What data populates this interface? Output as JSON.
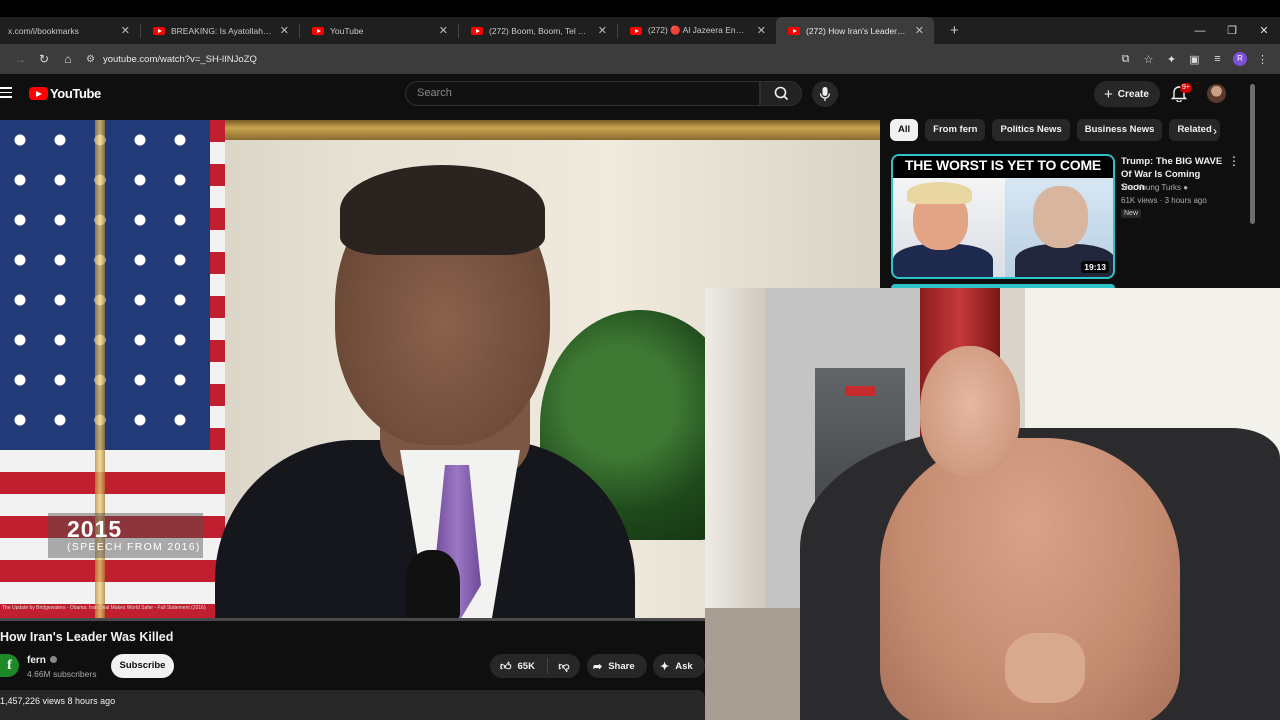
{
  "browser": {
    "tabs": [
      {
        "title": "x.com/i/bookmarks",
        "youtube": false,
        "active": false
      },
      {
        "title": "BREAKING: Is Ayatollah Dead? ",
        "youtube": true,
        "active": false
      },
      {
        "title": "YouTube",
        "youtube": true,
        "active": false
      },
      {
        "title": "(272) Boom, Boom, Tel Aviv (20",
        "youtube": true,
        "active": false
      },
      {
        "title": "(272) 🔴 Al Jazeera English | Li",
        "youtube": true,
        "active": false
      },
      {
        "title": "(272) How Iran's Leader Was Ki",
        "youtube": true,
        "active": true
      }
    ],
    "url": "youtube.com/watch?v=_SH-lINJoZQ",
    "profile_initial": "R"
  },
  "youtube": {
    "logo_text": "YouTube",
    "search_placeholder": "Search",
    "create_label": "Create",
    "notification_count": "9+"
  },
  "video": {
    "lower_third_year": "2015",
    "lower_third_sub": "(SPEECH FROM 2016)",
    "credit": "The Update by Bridgewaters - Obama: Iran Deal Makes World Safer - Full Statement (2016)",
    "progress": 0.0,
    "title": "How Iran's Leader Was Killed",
    "channel_initial": "f",
    "channel_name": "fern",
    "subscribers": "4.66M subscribers",
    "subscribe_label": "Subscribe",
    "likes": "65K",
    "share_label": "Share",
    "ask_label": "Ask",
    "views_line": "1,457,226 views  8 hours ago"
  },
  "sidebar": {
    "chips": [
      "All",
      "From fern",
      "Politics News",
      "Business News",
      "Related"
    ],
    "active_chip": "All",
    "recommendation": {
      "thumb_headline": "THE WORST IS YET TO COME",
      "duration": "19:13",
      "title": "Trump: The BIG WAVE Of War Is Coming Soon",
      "channel": "The Young Turks",
      "meta": "61K views · 3 hours ago",
      "badge": "New"
    }
  },
  "colors": {
    "accent_red": "#ff0000",
    "thumb_border": "#2dc3c8",
    "background": "#0f0f0f"
  }
}
